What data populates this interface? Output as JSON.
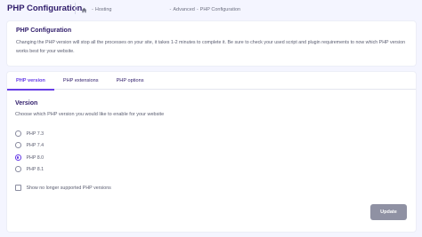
{
  "header": {
    "title": "PHP Configuration",
    "breadcrumbs": [
      "Hosting",
      "Advanced",
      "PHP Configuration"
    ],
    "separator": "-"
  },
  "info": {
    "title": "PHP Configuration",
    "text": "Changing the PHP version will stop all the processes on your site, it takes 1-2 minutes to complete it. Be sure to check your used script and plugin requirements to now which PHP version works best for your website."
  },
  "tabs": [
    {
      "label": "PHP version",
      "active": true
    },
    {
      "label": "PHP extensions",
      "active": false
    },
    {
      "label": "PHP options",
      "active": false
    }
  ],
  "version": {
    "title": "Version",
    "subtitle": "Choose which PHP version you would like to enable for your website",
    "options": [
      {
        "label": "PHP 7.3",
        "selected": false
      },
      {
        "label": "PHP 7.4",
        "selected": false
      },
      {
        "label": "PHP 8.0",
        "selected": true
      },
      {
        "label": "PHP 8.1",
        "selected": false
      }
    ],
    "checkbox_label": "Show no longer supported PHP versions",
    "checkbox_checked": false
  },
  "actions": {
    "update_label": "Update"
  },
  "colors": {
    "accent": "#673de6",
    "button_disabled": "#8f91a3",
    "background": "#f4f5ff"
  }
}
